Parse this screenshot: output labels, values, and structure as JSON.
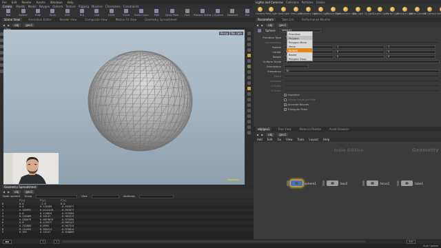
{
  "menubar": [
    "File",
    "Edit",
    "Render",
    "Assets",
    "Windows",
    "Help"
  ],
  "shelf": {
    "tabs": [
      "Create",
      "Modify",
      "Model",
      "Polygon",
      "Deform",
      "Texture",
      "Rigging",
      "Muscles",
      "Characters",
      "Constraints"
    ],
    "active_tab": "Create",
    "tools": [
      {
        "label": "Box",
        "color": "#8a8aa8"
      },
      {
        "label": "Sphere",
        "color": "#8a8aa8"
      },
      {
        "label": "Tube",
        "color": "#8a8aa8"
      },
      {
        "label": "Torus",
        "color": "#8a8aa8"
      },
      {
        "label": "Grid",
        "color": "#8a8aa8"
      },
      {
        "label": "Null",
        "color": "#8a8aa8"
      },
      {
        "label": "Line",
        "color": "#8a8aa8"
      },
      {
        "label": "Circle",
        "color": "#8a8aa8"
      },
      {
        "label": "Curve",
        "color": "#8a8aa8"
      },
      {
        "label": "Draw Curve",
        "color": "#8a8aa8"
      },
      {
        "label": "Path",
        "color": "#8a8aa8"
      },
      {
        "label": "Spray Paint",
        "color": "#8a8aa8"
      },
      {
        "label": "Font",
        "color": "#8a8aa8"
      },
      {
        "label": "Platonic Solids",
        "color": "#8a8aa8"
      },
      {
        "label": "L-System",
        "color": "#8a8aa8"
      },
      {
        "label": "Metaball",
        "color": "#8a8aa8"
      },
      {
        "label": "File",
        "color": "#8a8aa8"
      }
    ]
  },
  "lights": {
    "tabs": [
      "Lights and Cameras",
      "Collisions",
      "Particles",
      "Grains"
    ],
    "active_tab": "Lights and Cameras",
    "tools": [
      "Camera",
      "Point Light",
      "Spot Light",
      "Area Light",
      "Geometry Light",
      "Volume Light",
      "Distant Light",
      "Environment Light",
      "Sky Light",
      "GI Light",
      "Caustic Light",
      "Portal Light",
      "Ambient Light",
      "Stereo Camera",
      "VR Camera",
      "Switcher"
    ]
  },
  "left_pane": {
    "tabs": [
      "Scene View",
      "Animation Editor",
      "Render View",
      "Composite View",
      "Motion FX View",
      "Geometry Spreadsheet"
    ],
    "active_tab": "Scene View",
    "path": [
      "obj",
      "geo1"
    ]
  },
  "viewport": {
    "label": "View",
    "persp": "Persp",
    "camera": "No cam",
    "scale": "Geometry"
  },
  "spreadsheet": {
    "tabs": [
      "Geometry Spreadsheet",
      "Points"
    ],
    "path": [
      "obj",
      "geo1"
    ],
    "node_label": "Node: sphere1",
    "filter_group": "Group",
    "filter_view": "View",
    "filter_attrib": "Attributes",
    "columns": [
      "",
      "P[x]",
      "P[y]",
      "P[z]"
    ],
    "rows": [
      [
        "0",
        "0.0",
        "-1.0",
        "0.0"
      ],
      [
        "1",
        "0.0",
        "0.118469",
        "-0.992877"
      ],
      [
        "2",
        "0.105991",
        "0.0141419",
        "-0.992877"
      ],
      [
        "3",
        "0.0",
        "0.119824",
        "-0.975995"
      ],
      [
        "4",
        "0.118469",
        "0.15147",
        "-0.981217"
      ],
      [
        "5",
        "0.256679",
        "0.0879676",
        "-0.975995"
      ],
      [
        "6",
        "0.0",
        "0.119577",
        "-0.965147"
      ],
      [
        "7",
        "0.232883",
        "0.0995",
        "-0.967315"
      ],
      [
        "8",
        "0.114441",
        "0.184211",
        "-0.976014"
      ],
      [
        "9",
        "0.359",
        "0.15247",
        "-0.920669"
      ]
    ]
  },
  "params_pane": {
    "tabs": [
      "Parameters",
      "Take List",
      "Performance Monitor"
    ],
    "active_tab": "Parameters",
    "path": [
      "obj",
      "geo1"
    ],
    "node_type": "Sphere",
    "node_name": "sphere1",
    "rows": [
      {
        "label": "Primitive Type",
        "value": "Polygon",
        "dim": false
      },
      {
        "label": "Connectivity",
        "value": "",
        "dim": true
      },
      {
        "label": "Radius",
        "value": "1",
        "v2": "1",
        "v3": "1",
        "dim": false
      },
      {
        "label": "Center",
        "value": "0",
        "v2": "0",
        "v3": "0",
        "dim": false
      },
      {
        "label": "Rotate",
        "value": "0",
        "v2": "0",
        "v3": "0",
        "dim": false
      },
      {
        "label": "Uniform Scale",
        "value": "1",
        "dim": false
      },
      {
        "label": "Orientation",
        "value": "",
        "dim": false
      },
      {
        "label": "Frequency",
        "value": "10",
        "dim": false
      },
      {
        "label": "Rows",
        "value": "",
        "dim": true
      },
      {
        "label": "Columns",
        "value": "",
        "dim": true
      },
      {
        "label": "U Order",
        "value": "",
        "dim": true
      },
      {
        "label": "V Order",
        "value": "",
        "dim": true
      }
    ],
    "checks": [
      {
        "label": "Imperfect",
        "on": true,
        "dim": false
      },
      {
        "label": "Unique Points per Pole",
        "on": false,
        "dim": true
      },
      {
        "label": "Accurate Bounds",
        "on": true,
        "dim": false
      },
      {
        "label": "Triangular Poles",
        "on": true,
        "dim": false
      }
    ]
  },
  "dropdown": {
    "options": [
      "Primitive",
      "Polygon",
      "Polygon Mesh",
      "Mesh",
      "NURBS",
      "Bezier",
      "Polygon Soup"
    ],
    "current_index": 1,
    "hover_index": 4
  },
  "network_pane": {
    "tabs": [
      "obj/geo1",
      "Tree View",
      "Material Palette",
      "Asset Browser"
    ],
    "path": [
      "obj",
      "geo1"
    ],
    "menu": [
      "Add",
      "Edit",
      "Go",
      "View",
      "Tools",
      "Layout",
      "Help"
    ],
    "watermark_left": "Indie Edition",
    "watermark_right": "Geometry",
    "nodes": [
      {
        "name": "sphere1",
        "selected": true
      },
      {
        "name": "box2",
        "selected": false
      },
      {
        "name": "torus1",
        "selected": false
      },
      {
        "name": "tube1",
        "selected": false
      }
    ]
  },
  "timeline": {
    "frame_start": "1",
    "frame_current": "1",
    "frame_end": "240"
  },
  "status": {
    "left": "",
    "right": "Auto Update"
  }
}
